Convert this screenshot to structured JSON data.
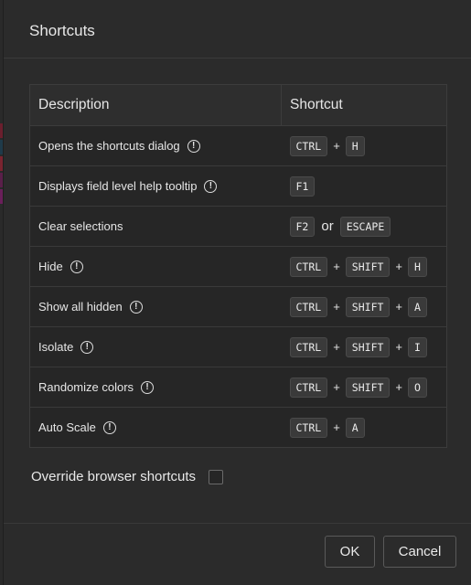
{
  "dialog": {
    "title": "Shortcuts",
    "colors": {
      "background": "#2b2b2b",
      "border": "#3c3c3c",
      "key_bg": "#3a3a3a"
    }
  },
  "table": {
    "headers": {
      "description": "Description",
      "shortcut": "Shortcut"
    },
    "rows": [
      {
        "description": "Opens the shortcuts dialog",
        "info": true,
        "keys": [
          "CTRL",
          "H"
        ],
        "separators": [
          "+"
        ]
      },
      {
        "description": "Displays field level help tooltip",
        "info": true,
        "keys": [
          "F1"
        ],
        "separators": []
      },
      {
        "description": "Clear selections",
        "info": false,
        "keys": [
          "F2",
          "ESCAPE"
        ],
        "separators": [
          "or"
        ]
      },
      {
        "description": "Hide",
        "info": true,
        "keys": [
          "CTRL",
          "SHIFT",
          "H"
        ],
        "separators": [
          "+",
          "+"
        ]
      },
      {
        "description": "Show all hidden",
        "info": true,
        "keys": [
          "CTRL",
          "SHIFT",
          "A"
        ],
        "separators": [
          "+",
          "+"
        ]
      },
      {
        "description": "Isolate",
        "info": true,
        "keys": [
          "CTRL",
          "SHIFT",
          "I"
        ],
        "separators": [
          "+",
          "+"
        ]
      },
      {
        "description": "Randomize colors",
        "info": true,
        "keys": [
          "CTRL",
          "SHIFT",
          "O"
        ],
        "separators": [
          "+",
          "+"
        ]
      },
      {
        "description": "Auto Scale",
        "info": true,
        "keys": [
          "CTRL",
          "A"
        ],
        "separators": [
          "+"
        ]
      }
    ]
  },
  "override": {
    "label": "Override browser shortcuts",
    "checked": false
  },
  "footer": {
    "ok_label": "OK",
    "cancel_label": "Cancel"
  },
  "icons": {
    "info": "info-circle-icon",
    "info_glyph": "!"
  }
}
